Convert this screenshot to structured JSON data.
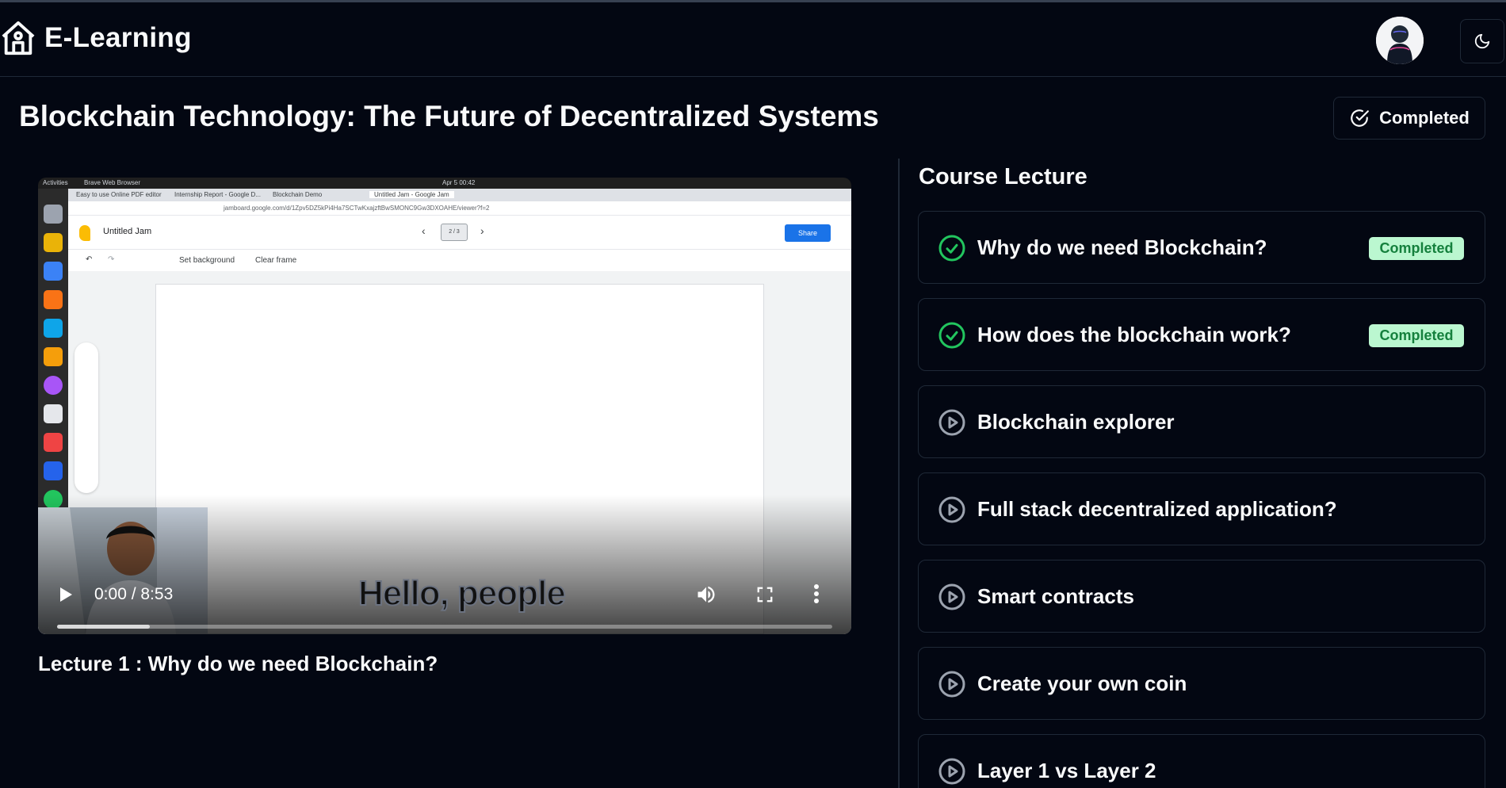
{
  "app": {
    "name": "E-Learning"
  },
  "course": {
    "title": "Blockchain Technology: The Future of Decentralized Systems",
    "status_label": "Completed"
  },
  "video": {
    "time": "0:00 / 8:53",
    "progress_buffered": 0.12,
    "subtitle": "Hello, people",
    "screen": {
      "activities": "Activities",
      "browser_label": "Brave Web Browser",
      "clock": "Apr 5  00:42",
      "tabs": [
        "Easy to use Online PDF editor",
        "Internship Report - Google D...",
        "Blockchain Demo",
        "Untitled Jam - Google Jam"
      ],
      "url": "jamboard.google.com/d/1Zpv5DZ5kPi4Ha7SCTwKxajzftBwSMONC9Gw3DXOAHE/viewer?f=2",
      "doc_title": "Untitled Jam",
      "frame_indicator": "2 / 3",
      "share_label": "Share",
      "toolbar": {
        "set_background": "Set background",
        "clear_frame": "Clear frame"
      }
    }
  },
  "current_lecture": "Lecture 1 : Why do we need Blockchain?",
  "panel": {
    "title": "Course Lecture",
    "lectures": [
      {
        "title": "Why do we need Blockchain?",
        "status": "Completed",
        "icon": "check-circle-icon"
      },
      {
        "title": "How does the blockchain work?",
        "status": "Completed",
        "icon": "check-circle-icon"
      },
      {
        "title": "Blockchain explorer",
        "status": "",
        "icon": "play-circle-icon"
      },
      {
        "title": "Full stack decentralized application?",
        "status": "",
        "icon": "play-circle-icon"
      },
      {
        "title": "Smart contracts",
        "status": "",
        "icon": "play-circle-icon"
      },
      {
        "title": "Create your own coin",
        "status": "",
        "icon": "play-circle-icon"
      },
      {
        "title": "Layer 1 vs Layer 2",
        "status": "",
        "icon": "play-circle-icon"
      }
    ]
  },
  "colors": {
    "background": "#030712",
    "border": "#1f2937",
    "success": "#22c55e",
    "badge_bg": "#bbf7d0",
    "badge_text": "#15803d"
  }
}
